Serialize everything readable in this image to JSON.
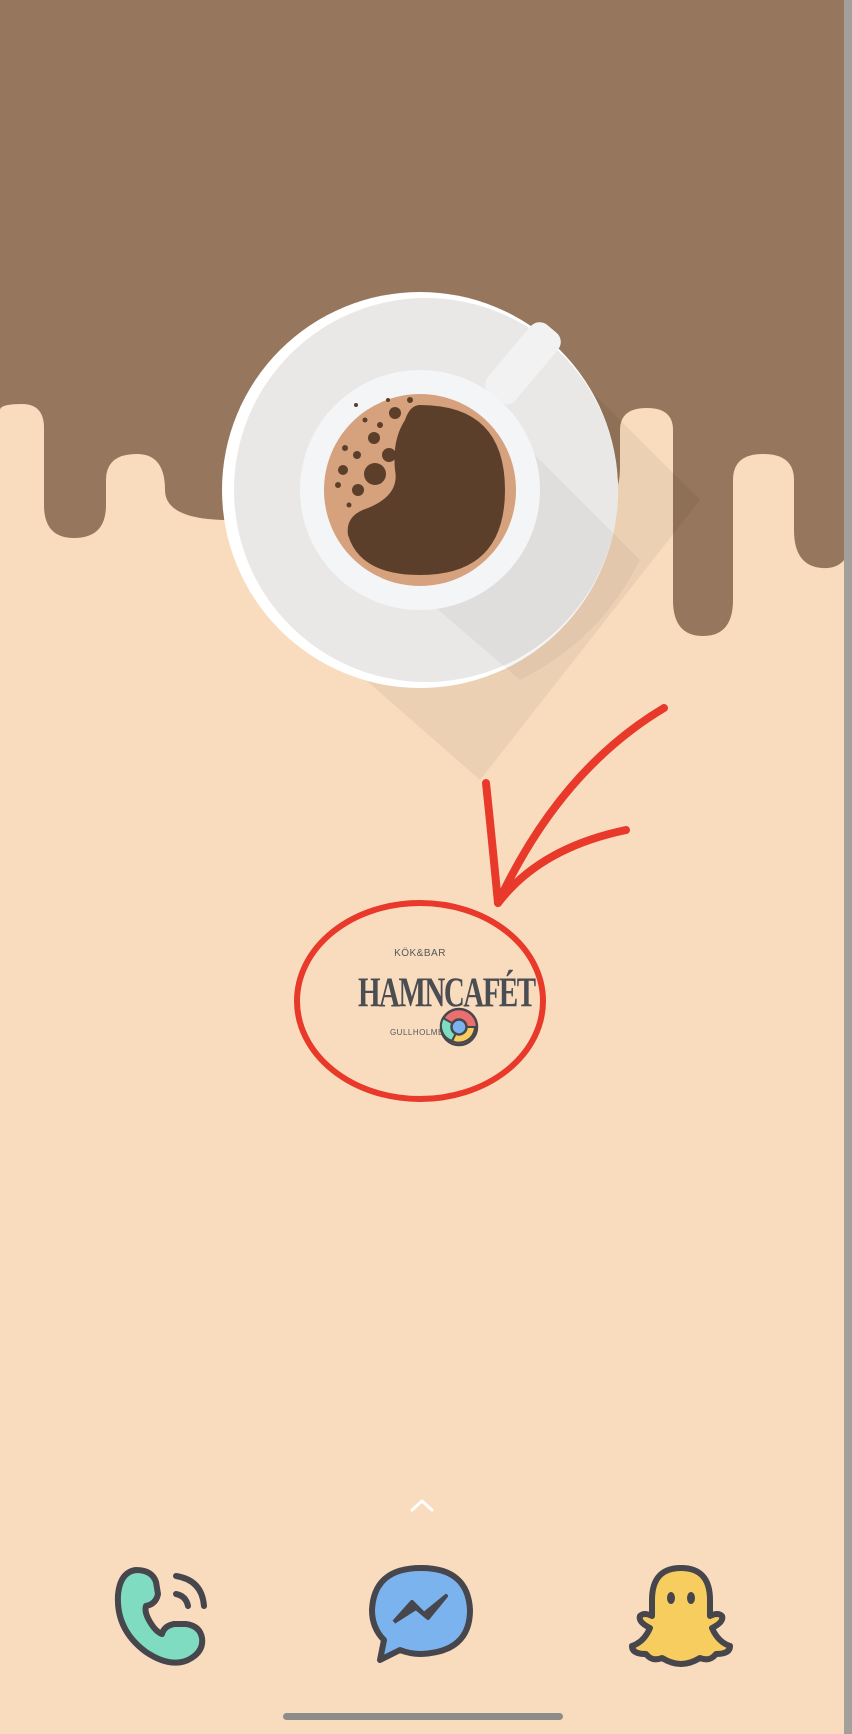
{
  "screen": {
    "type": "android-home-screen",
    "wallpaper": {
      "description_colors": {
        "drip": "#96765c",
        "background": "#f9dcbe",
        "saucer": "#e9e8e7",
        "coffee": "#5c3f2a",
        "crema": "#d6a27d"
      }
    }
  },
  "shortcut": {
    "line1": "KÖK&BAR",
    "line2": "HAMNCAFÉT",
    "line3": "GULLHOLMEN",
    "badge_icon": "chrome-icon"
  },
  "annotation": {
    "color": "#e8392a",
    "type": "red-circle-and-arrow"
  },
  "drawer": {
    "icon": "chevron-up-icon"
  },
  "dock": [
    {
      "name": "Phone",
      "icon": "phone-icon",
      "color": "#7fdcc0"
    },
    {
      "name": "Messenger",
      "icon": "messenger-icon",
      "color": "#7bb3ee"
    },
    {
      "name": "Snapchat",
      "icon": "snapchat-ghost-icon",
      "color": "#f8cd5f"
    }
  ]
}
